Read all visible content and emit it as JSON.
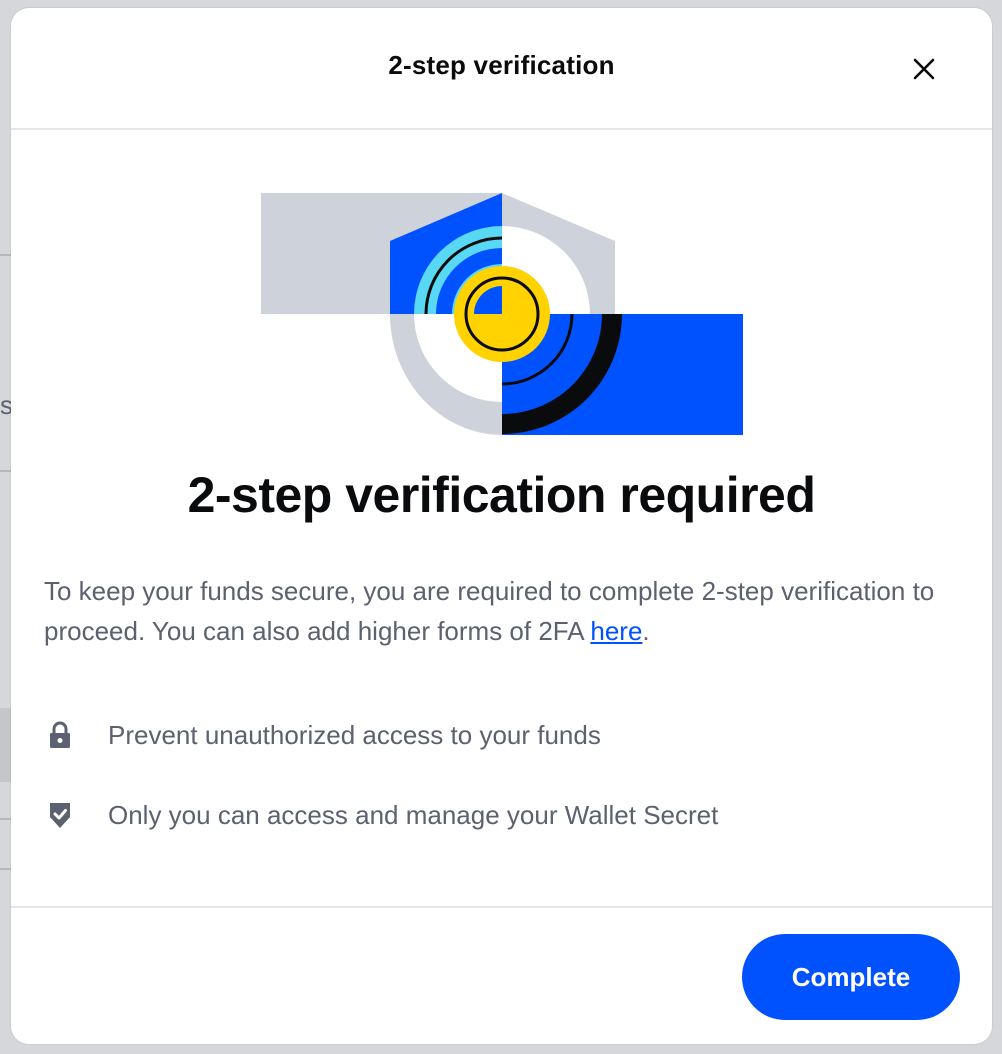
{
  "modal": {
    "title": "2-step verification",
    "headline": "2-step verification required",
    "description_text": "To keep your funds secure, you are required to complete 2-step verification to proceed. You can also add higher forms of 2FA ",
    "description_link": "here",
    "description_end": ".",
    "features": [
      {
        "icon": "lock-icon",
        "text": "Prevent unauthorized access to your funds"
      },
      {
        "icon": "shield-check-icon",
        "text": "Only you can access and manage your Wallet Secret"
      }
    ],
    "complete_label": "Complete"
  },
  "background": {
    "partial_char": "s"
  },
  "colors": {
    "primary_blue": "#0052ff",
    "text_primary": "#0a0b0d",
    "text_secondary": "#5b616e",
    "illustration_gray": "#ced2da",
    "illustration_yellow": "#ffd200",
    "illustration_cyan": "#58d8f5"
  }
}
